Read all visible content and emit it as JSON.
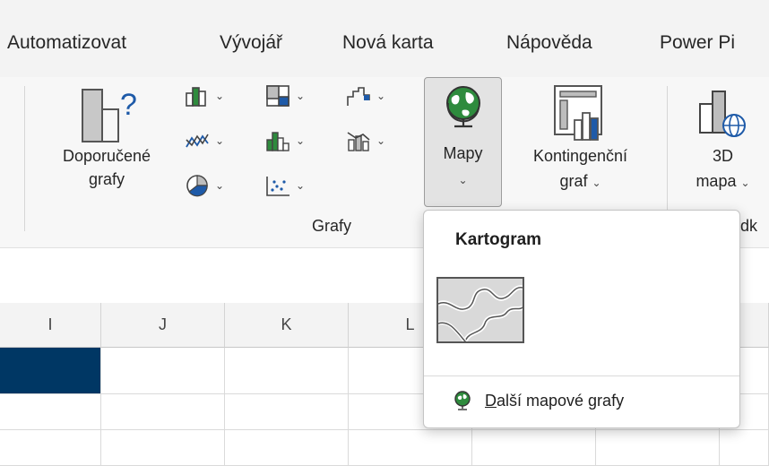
{
  "tabs": [
    {
      "label": "Automatizovat"
    },
    {
      "label": "Vývojář"
    },
    {
      "label": "Nová karta"
    },
    {
      "label": "Nápověda"
    },
    {
      "label": "Power Pi"
    }
  ],
  "ribbon": {
    "recommended": {
      "line1": "Doporučené",
      "line2": "grafy"
    },
    "group_label": "Grafy",
    "maps": {
      "label": "Mapy"
    },
    "pivot": {
      "line1": "Kontingenční",
      "line2": "graf"
    },
    "map3d": {
      "line1": "3D",
      "line2": "mapa"
    },
    "clipped_group_label": "dk"
  },
  "grid": {
    "columns": [
      "I",
      "J",
      "K",
      "L"
    ],
    "selected_fill": "#003764"
  },
  "dropdown": {
    "title": "Kartogram",
    "more_prefix": "D",
    "more_rest": "alší mapové grafy"
  },
  "colors": {
    "globe_green": "#2e8b3d",
    "globe_blue": "#1e5aa8",
    "accent_blue": "#1e5aa8"
  }
}
